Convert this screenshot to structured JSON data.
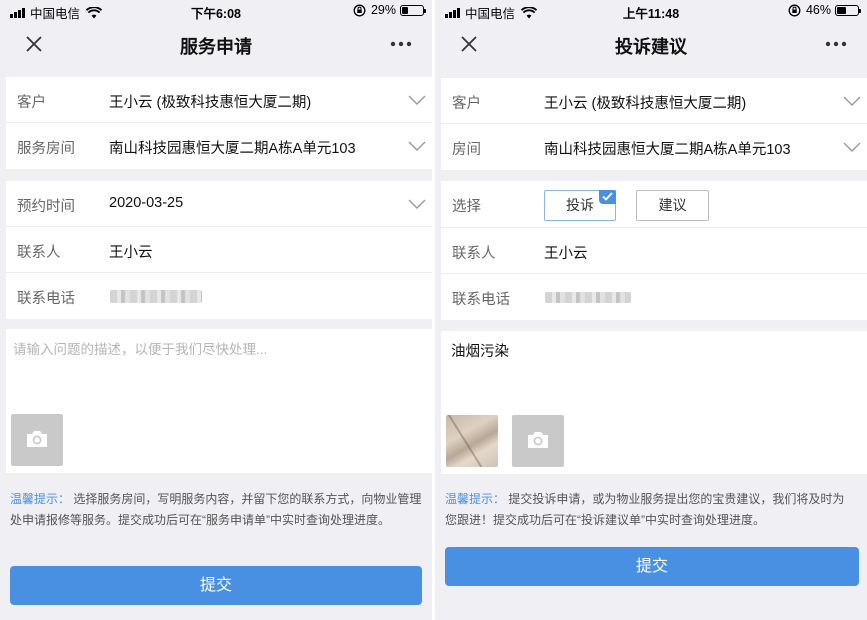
{
  "left": {
    "status": {
      "carrier": "中国电信",
      "time": "下午6:08",
      "battery": "29%",
      "battery_level": 0.29
    },
    "nav": {
      "title": "服务申请"
    },
    "rows": [
      {
        "label": "客户",
        "value": "王小云 (极致科技惠恒大厦二期)",
        "dropdown": true
      },
      {
        "label": "服务房间",
        "value": "南山科技园惠恒大厦二期A栋A单元103",
        "dropdown": true
      },
      {
        "label": "预约时间",
        "value": "2020-03-25",
        "dropdown": true
      },
      {
        "label": "联系人",
        "value": "王小云",
        "dropdown": false
      },
      {
        "label": "联系电话",
        "value": "",
        "dropdown": false
      }
    ],
    "description_placeholder": "请输入问题的描述，以便于我们尽快处理...",
    "tip_title": "温馨提示：",
    "tip_text": "选择服务房间，写明服务内容，并留下您的联系方式，向物业管理处申请报修等服务。提交成功后可在“服务申请单”中实时查询处理进度。",
    "submit_label": "提交"
  },
  "right": {
    "status": {
      "carrier": "中国电信",
      "time": "上午11:48",
      "battery": "46%",
      "battery_level": 0.46
    },
    "nav": {
      "title": "投诉建议"
    },
    "rows": [
      {
        "label": "客户",
        "value": "王小云 (极致科技惠恒大厦二期)",
        "dropdown": true
      },
      {
        "label": "房间",
        "value": "南山科技园惠恒大厦二期A栋A单元103",
        "dropdown": true
      }
    ],
    "select_label": "选择",
    "options": [
      {
        "label": "投诉",
        "selected": true
      },
      {
        "label": "建议",
        "selected": false
      }
    ],
    "contact_label": "联系人",
    "contact_value": "王小云",
    "phone_label": "联系电话",
    "description_text": "油烟污染",
    "tip_title": "温馨提示：",
    "tip_text": "提交投诉申请，或为物业服务提出您的宝贵建议，我们将及时为您跟进！提交成功后可在“投诉建议单”中实时查询处理进度。",
    "submit_label": "提交"
  },
  "colors": {
    "accent": "#4a90e2",
    "background": "#efeff4"
  },
  "icons": [
    "signal-icon",
    "wifi-icon",
    "rotation-lock-icon",
    "battery-icon",
    "close-icon",
    "more-icon",
    "chevron-down-icon",
    "camera-icon",
    "checkmark-icon"
  ]
}
